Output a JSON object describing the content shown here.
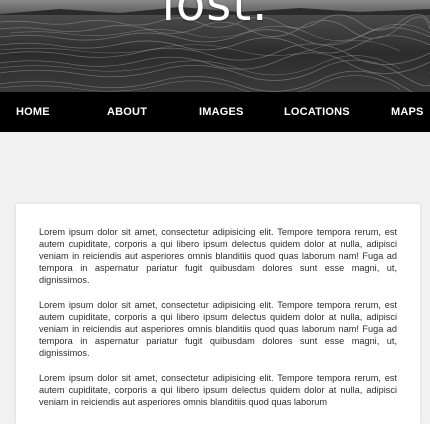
{
  "hero": {
    "title": "lost."
  },
  "nav": {
    "items": [
      {
        "label": "HOME"
      },
      {
        "label": "ABOUT"
      },
      {
        "label": "IMAGES"
      },
      {
        "label": "LOCATIONS"
      },
      {
        "label": "MAPS"
      }
    ]
  },
  "content": {
    "paragraphs": [
      "Lorem ipsum dolor sit amet, consectetur adipisicing elit. Tempore tempora rerum, est autem cupiditate, corporis a qui libero ipsum delectus quidem dolor at nulla, adipisci veniam in reiciendis aut asperiores omnis blanditiis quod quas laborum nam! Fuga ad tempora in aspernatur pariatur fugit quibusdam dolores sunt esse magni, ut, dignissimos.",
      "Lorem ipsum dolor sit amet, consectetur adipisicing elit. Tempore tempora rerum, est autem cupiditate, corporis a qui libero ipsum delectus quidem dolor at nulla, adipisci veniam in reiciendis aut asperiores omnis blanditiis quod quas laborum nam! Fuga ad tempora in aspernatur pariatur fugit quibusdam dolores sunt esse magni, ut, dignissimos.",
      "Lorem ipsum dolor sit amet, consectetur adipisicing elit. Tempore tempora rerum, est autem cupiditate, corporis a qui libero ipsum delectus quidem dolor at nulla, adipisci veniam in reiciendis aut asperiores omnis blanditiis quod quas laborum"
    ]
  }
}
